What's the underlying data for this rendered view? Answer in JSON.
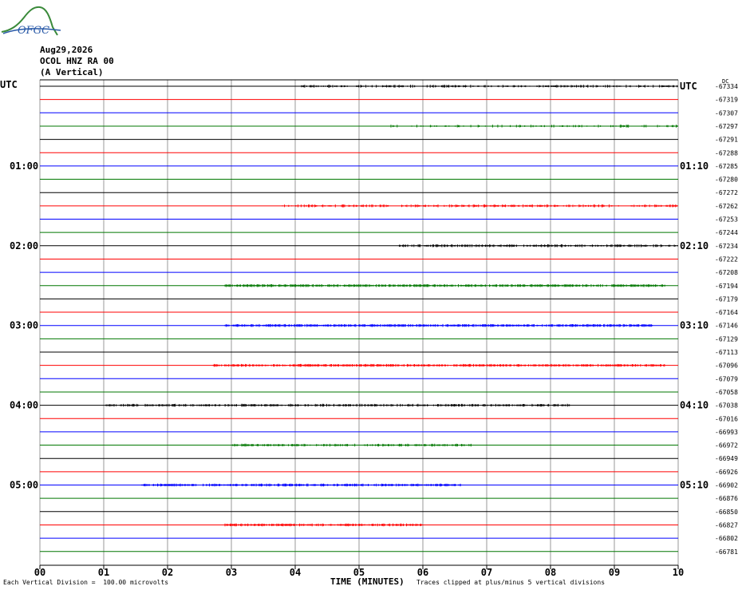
{
  "station": {
    "logo_text": "OFGC",
    "date": "Aug29,2026",
    "channel": "OCOL HNZ RA 00",
    "component": "(A Vertical)"
  },
  "footer": {
    "division": "Each Vertical Division =  100.00 microvolts",
    "clip_note": "Traces clipped at plus/minus 5 vertical divisions"
  },
  "chart_data": {
    "type": "line",
    "title": "",
    "xlabel": "TIME (MINUTES)",
    "x_ticks": [
      "00",
      "01",
      "02",
      "03",
      "04",
      "05",
      "06",
      "07",
      "08",
      "09",
      "10"
    ],
    "xlim": [
      0,
      10
    ],
    "left_axis_title": "UTC",
    "right_axis_title": "UTC",
    "left_time_labels": [
      {
        "row": 6,
        "label": "01:00"
      },
      {
        "row": 12,
        "label": "02:00"
      },
      {
        "row": 18,
        "label": "03:00"
      },
      {
        "row": 24,
        "label": "04:00"
      },
      {
        "row": 30,
        "label": "05:00"
      }
    ],
    "right_time_labels": [
      {
        "row": 0,
        "label": "UTC"
      },
      {
        "row": 6,
        "label": "01:10"
      },
      {
        "row": 12,
        "label": "02:10"
      },
      {
        "row": 18,
        "label": "03:10"
      },
      {
        "row": 24,
        "label": "04:10"
      },
      {
        "row": 30,
        "label": "05:10"
      }
    ],
    "dc_label": "DC",
    "trace_colors": [
      "#000000",
      "#ff0000",
      "#0000ff",
      "#007700"
    ],
    "dc_offsets": [
      "-67334",
      "-67319",
      "-67307",
      "-67297",
      "-67291",
      "-67288",
      "-67285",
      "-67280",
      "-67272",
      "-67262",
      "-67253",
      "-67244",
      "-67234",
      "-67222",
      "-67208",
      "-67194",
      "-67179",
      "-67164",
      "-67146",
      "-67129",
      "-67113",
      "-67096",
      "-67079",
      "-67058",
      "-67038",
      "-67016",
      "-66993",
      "-66972",
      "-66949",
      "-66926",
      "-66902",
      "-66876",
      "-66850",
      "-66827",
      "-66802",
      "-66781"
    ],
    "activity": [
      [
        4.1,
        10,
        0.5
      ],
      [
        0,
        0,
        0
      ],
      [
        0,
        0,
        0
      ],
      [
        5.5,
        10,
        0.25
      ],
      [
        0,
        0,
        0
      ],
      [
        0,
        0,
        0
      ],
      [
        0,
        0,
        0
      ],
      [
        0,
        0,
        0
      ],
      [
        0,
        0,
        0
      ],
      [
        3.8,
        10,
        0.5
      ],
      [
        0,
        0,
        0
      ],
      [
        0,
        0,
        0
      ],
      [
        5.6,
        10,
        0.7
      ],
      [
        0,
        0,
        0
      ],
      [
        0,
        0,
        0
      ],
      [
        2.9,
        9.8,
        0.85
      ],
      [
        0,
        0,
        0
      ],
      [
        0,
        0,
        0
      ],
      [
        2.9,
        9.6,
        0.9
      ],
      [
        0,
        0,
        0
      ],
      [
        0,
        0,
        0
      ],
      [
        2.7,
        9.8,
        0.85
      ],
      [
        0,
        0,
        0
      ],
      [
        0,
        0,
        0
      ],
      [
        1.0,
        8.3,
        0.7
      ],
      [
        0,
        0,
        0
      ],
      [
        0,
        0,
        0
      ],
      [
        3.0,
        6.8,
        0.6
      ],
      [
        0,
        0,
        0
      ],
      [
        0,
        0,
        0
      ],
      [
        1.6,
        6.6,
        0.85
      ],
      [
        0,
        0,
        0
      ],
      [
        0,
        0,
        0
      ],
      [
        2.9,
        6.0,
        0.85
      ],
      [
        0,
        0,
        0
      ],
      [
        0,
        0,
        0
      ]
    ]
  }
}
